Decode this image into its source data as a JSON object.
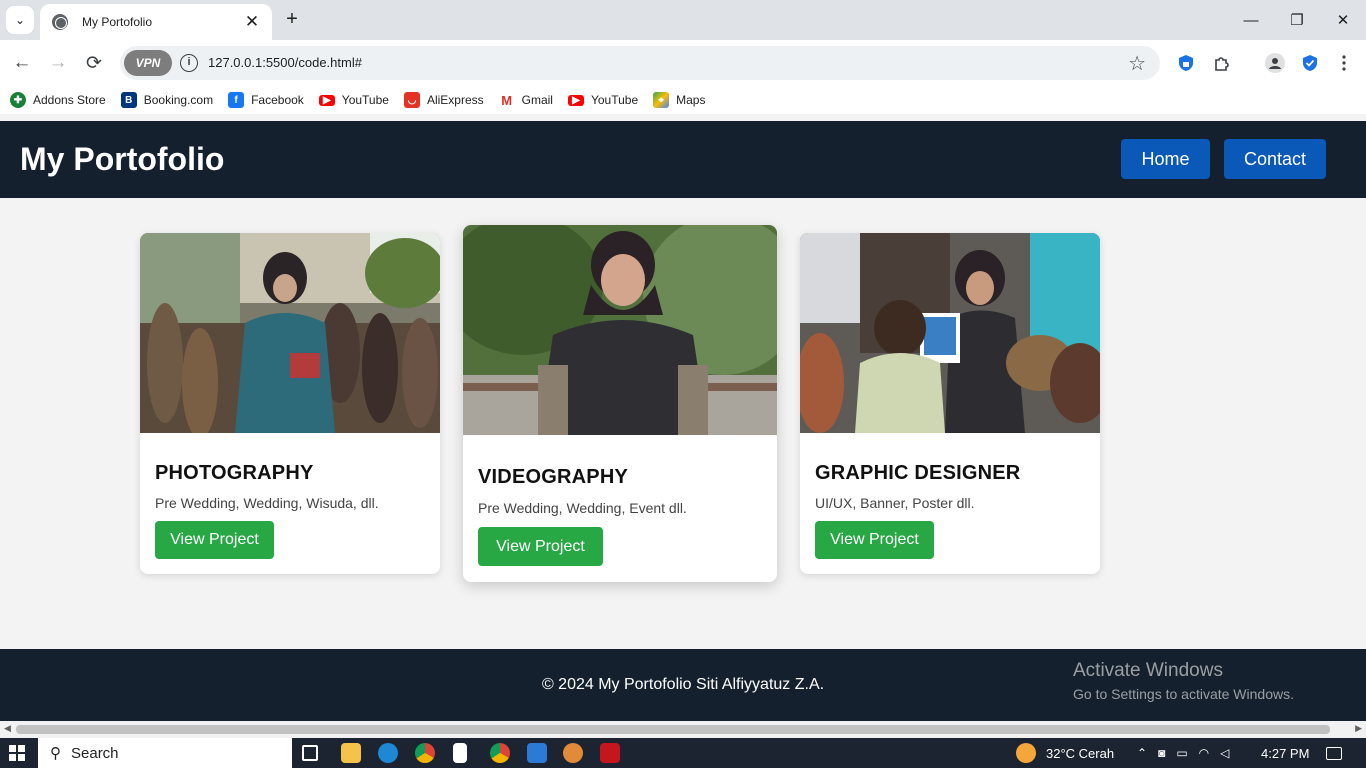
{
  "browser": {
    "tab_title": "My Portofolio",
    "url": "127.0.0.1:5500/code.html#",
    "vpn_label": "VPN",
    "bookmarks": [
      {
        "label": "Addons Store",
        "icon": "addons-store-icon",
        "color": "#1a7f37"
      },
      {
        "label": "Booking.com",
        "icon": "booking-icon",
        "color": "#003580"
      },
      {
        "label": "Facebook",
        "icon": "facebook-icon",
        "color": "#1877f2"
      },
      {
        "label": "YouTube",
        "icon": "youtube-icon",
        "color": "#ff0000"
      },
      {
        "label": "AliExpress",
        "icon": "aliexpress-icon",
        "color": "#e43225"
      },
      {
        "label": "Gmail",
        "icon": "gmail-icon",
        "color": "#d93025"
      },
      {
        "label": "YouTube",
        "icon": "youtube-icon",
        "color": "#ff0000"
      },
      {
        "label": "Maps",
        "icon": "maps-icon",
        "color": "#34a853"
      }
    ]
  },
  "site": {
    "title": "My Portofolio",
    "nav": {
      "home": "Home",
      "contact": "Contact"
    },
    "cards": [
      {
        "heading": "PHOTOGRAPHY",
        "description": "Pre Wedding, Wedding, Wisuda, dll.",
        "button": "View Project"
      },
      {
        "heading": "VIDEOGRAPHY",
        "description": "Pre Wedding, Wedding, Event dll.",
        "button": "View Project"
      },
      {
        "heading": "GRAPHIC DESIGNER",
        "description": "UI/UX, Banner, Poster dll.",
        "button": "View Project"
      }
    ],
    "footer": "© 2024 My Portofolio Siti Alfiyyatuz Z.A."
  },
  "watermark": {
    "line1": "Activate Windows",
    "line2": "Go to Settings to activate Windows."
  },
  "taskbar": {
    "search_label": "Search",
    "weather": "32°C  Cerah",
    "time": "4:27 PM"
  },
  "colors": {
    "header_bg": "#14202e",
    "nav_button": "#0a58b8",
    "project_button": "#28a745",
    "page_bg": "#f3f3f3"
  }
}
